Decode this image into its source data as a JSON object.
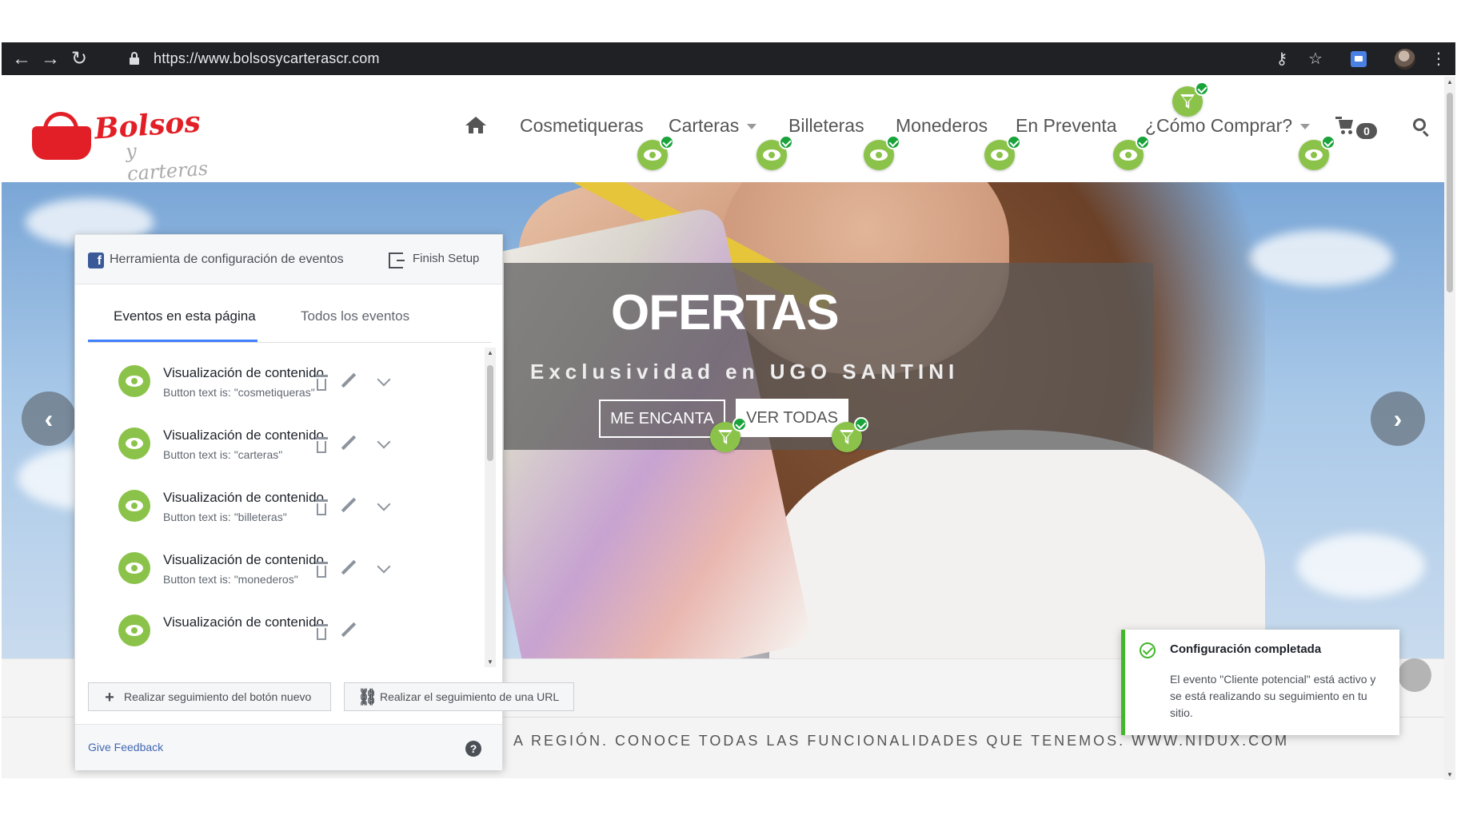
{
  "browser": {
    "url": "https://www.bolsosycarterascr.com",
    "back_icon": "arrow-left-icon",
    "forward_icon": "arrow-right-icon",
    "reload_icon": "reload-icon"
  },
  "site": {
    "logo": {
      "line1": "Bolsos",
      "line2": "y carteras"
    },
    "nav": {
      "items": [
        {
          "label": "Cosmetiqueras",
          "dropdown": false
        },
        {
          "label": "Carteras",
          "dropdown": true
        },
        {
          "label": "Billeteras",
          "dropdown": false
        },
        {
          "label": "Monederos",
          "dropdown": false
        },
        {
          "label": "En Preventa",
          "dropdown": false
        },
        {
          "label": "¿Cómo Comprar?",
          "dropdown": true
        }
      ],
      "cart_count": "0"
    },
    "hero": {
      "title": "OFERTAS",
      "subtitle": "Exclusividad en UGO SANTINI",
      "btn_love": "ME ENCANTA",
      "btn_all": "VER TODAS",
      "prev_arrow": "‹",
      "next_arrow": "›"
    },
    "ticker": "A REGIÓN. CONOCE TODAS LAS FUNCIONALIDADES QUE TENEMOS. WWW.NIDUX.COM"
  },
  "fb_panel": {
    "title": "Herramienta de configuración de eventos",
    "finish": "Finish Setup",
    "tabs": [
      "Eventos en esta página",
      "Todos los eventos"
    ],
    "events": [
      {
        "title": "Visualización de contenido",
        "desc": "Button text is: \"cosmetiqueras\""
      },
      {
        "title": "Visualización de contenido",
        "desc": "Button text is: \"carteras\""
      },
      {
        "title": "Visualización de contenido",
        "desc": "Button text is: \"billeteras\""
      },
      {
        "title": "Visualización de contenido",
        "desc": "Button text is: \"monederos\""
      },
      {
        "title": "Visualización de contenido",
        "desc": ""
      }
    ],
    "btn_new": "Realizar seguimiento del botón nuevo",
    "btn_url": "Realizar el seguimiento de una URL",
    "feedback": "Give Feedback",
    "help": "?"
  },
  "toast": {
    "title": "Configuración completada",
    "body": "El evento \"Cliente potencial\" está activo y se está realizando su seguimiento en tu sitio."
  },
  "colors": {
    "badge_green": "#8bc34a",
    "check_green": "#1aa33a",
    "fb_blue": "#3b5998",
    "brand_red": "#e21f26"
  }
}
